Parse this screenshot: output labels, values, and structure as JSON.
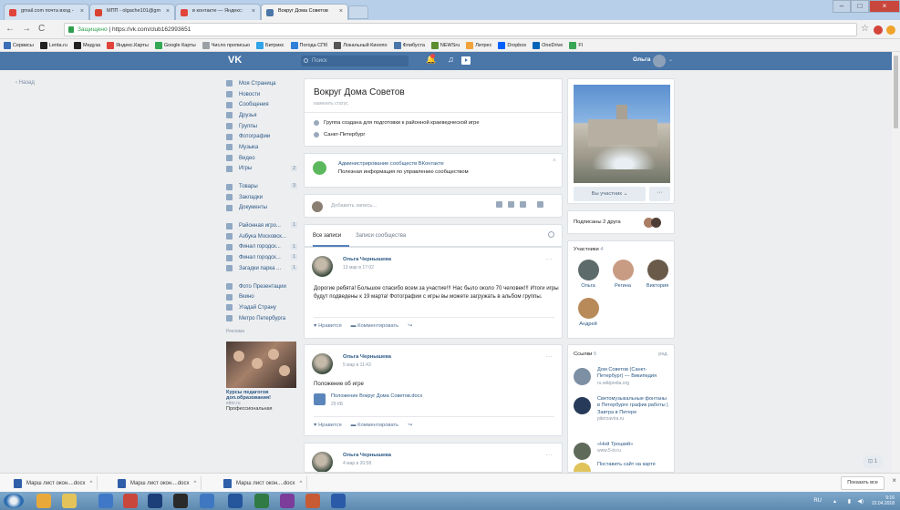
{
  "browser": {
    "tabs": [
      {
        "title": "gmail.com почта вход - ",
        "icon_color": "#e0443b"
      },
      {
        "title": "МПП - olgache101@gm",
        "icon_color": "#d8432f"
      },
      {
        "title": "в контакте — Яндекс: ",
        "icon_color": "#e0443b"
      },
      {
        "title": "Вокруг Дома Советов",
        "icon_color": "#4a76a8"
      }
    ],
    "address_secure": "Защищено",
    "address_url": "https://vk.com/club162993651",
    "bookmarks": [
      {
        "label": "Сервисы",
        "color": "#3b6fb6"
      },
      {
        "label": "Lenta.ru",
        "color": "#222222"
      },
      {
        "label": "Медуза",
        "color": "#222222"
      },
      {
        "label": "Яндекс.Карты",
        "color": "#e0443b"
      },
      {
        "label": "Google Карты",
        "color": "#34a853"
      },
      {
        "label": "Число прописью",
        "color": "#9aa0a6"
      },
      {
        "label": "Битрикс",
        "color": "#2fa4e7"
      },
      {
        "label": "Погода СПб",
        "color": "#2f7fd8"
      },
      {
        "label": "Локальный Кинопо",
        "color": "#555555"
      },
      {
        "label": "Флибуста",
        "color": "#4a76a8"
      },
      {
        "label": "NEWSru",
        "color": "#5c8d2f"
      },
      {
        "label": "Литрес",
        "color": "#f1a33a"
      },
      {
        "label": "Dropbox",
        "color": "#0061fe"
      },
      {
        "label": "OneDrive",
        "color": "#0364b8"
      },
      {
        "label": "Fl",
        "color": "#3aa655"
      }
    ]
  },
  "vk": {
    "logo": "VK",
    "search_placeholder": "Поиск",
    "user_name": "Ольга",
    "back_label": "Назад",
    "nav": [
      {
        "label": "Моя Страница",
        "count": ""
      },
      {
        "label": "Новости",
        "count": ""
      },
      {
        "label": "Сообщения",
        "count": ""
      },
      {
        "label": "Друзья",
        "count": ""
      },
      {
        "label": "Группы",
        "count": ""
      },
      {
        "label": "Фотографии",
        "count": ""
      },
      {
        "label": "Музыка",
        "count": ""
      },
      {
        "label": "Видео",
        "count": ""
      },
      {
        "label": "Игры",
        "count": "2"
      },
      {
        "label": "",
        "count": "",
        "gap": true
      },
      {
        "label": "Товары",
        "count": "3"
      },
      {
        "label": "Закладки",
        "count": ""
      },
      {
        "label": "Документы",
        "count": ""
      },
      {
        "label": "",
        "count": "",
        "gap": true
      },
      {
        "label": "Районная игро...",
        "count": "1"
      },
      {
        "label": "Азбука Московск...",
        "count": ""
      },
      {
        "label": "Финал городск...",
        "count": "1"
      },
      {
        "label": "Финал городск...",
        "count": "1"
      },
      {
        "label": "Загадки парка ...",
        "count": "1"
      },
      {
        "label": "",
        "count": "",
        "gap": true
      },
      {
        "label": "Фото Презентации",
        "count": ""
      },
      {
        "label": "Вкино",
        "count": ""
      },
      {
        "label": "Угадай Страну",
        "count": ""
      },
      {
        "label": "Метро Петербурга",
        "count": ""
      }
    ],
    "ad": {
      "section": "Реклама",
      "title": "Курсы педагогов доп.образования!",
      "site": "ettor.ru",
      "text": "Профессиональная"
    },
    "group": {
      "title": "Вокруг Дома Советов",
      "status": "изменить статус",
      "description": "Группа создана для подготовки к районной краеведческой игре",
      "city": "Санкт-Петербург"
    },
    "admin_banner": {
      "title": "Администрирование сообществ ВКонтакте",
      "desc": "Полезная информация по управлению сообществом"
    },
    "composer_placeholder": "Добавить запись...",
    "wall_tabs": {
      "all": "Все записи",
      "community": "Записи сообщества"
    },
    "posts": [
      {
        "author": "Ольга Чернышева",
        "date": "13 мар в 17:02",
        "text": "Дорогие ребята! Большое спасибо всем за участие!!! Нас было около 70 человек!!! Итоги игры будут подведены к 19 марта! Фотографии с игры вы можете загружать в альбом группы.",
        "like": "Нравится",
        "comment": "Комментировать"
      },
      {
        "author": "Ольга Чернышева",
        "date": "5 мар в 11:43",
        "text": "Положение об игре",
        "doc_title": "Положение Вокруг Дома Советов.docx",
        "doc_size": "29 КБ",
        "like": "Нравится",
        "comment": "Комментировать"
      },
      {
        "author": "Ольга Чернышева",
        "date": "4 мар в 20:58"
      }
    ],
    "right": {
      "member_button": "Вы участник ⌄",
      "more_button": "···",
      "friends_text": "Подписаны 2 друга",
      "members_label": "Участники",
      "members_count": "4",
      "members": [
        {
          "name": "Ольга",
          "color": "#5d6b6b"
        },
        {
          "name": "Регина",
          "color": "#c89b83"
        },
        {
          "name": "Виктория",
          "color": "#6a5a4a"
        },
        {
          "name": "Андрей",
          "color": "#b88a5a"
        }
      ],
      "links_label": "Ссылки",
      "links_count": "5",
      "links_edit": "ред.",
      "links": [
        {
          "title": "Дом Советов (Санкт-Петербург) — Википедия",
          "site": "ru.wikipedia.org",
          "color": "#7d8fa3"
        },
        {
          "title": "Светомузыкальные фонтаны в Петербурге график работы | Завтра в Питере",
          "site": "piterzavtra.ru",
          "color": "#283a59"
        },
        {
          "title": "«Ной Троцкий»",
          "site": "www.5-tv.ru",
          "color": "#5f6a5b"
        },
        {
          "title": "Поставить сайт на карте",
          "site": "",
          "color": "#e0c35a"
        }
      ]
    },
    "corner_button": "⊡ 1"
  },
  "downloads": {
    "items": [
      "Марш лист окон....docx",
      "Марш лист окон....docx",
      "Марш лист окон....docx"
    ],
    "show_all": "Показать все"
  },
  "taskbar": {
    "lang": "RU",
    "time": "9:16",
    "date": "22.04.2018"
  }
}
